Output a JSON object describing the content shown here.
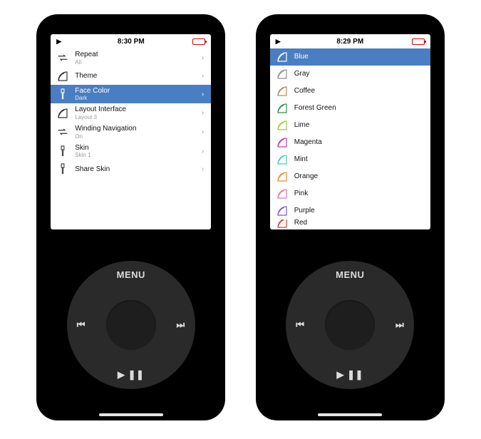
{
  "left": {
    "status": {
      "play_glyph": "▶",
      "time": "8:30 PM"
    },
    "items": [
      {
        "icon": "repeat",
        "label": "Repeat",
        "sub": "All",
        "chev": "›",
        "selected": false
      },
      {
        "icon": "fan",
        "label": "Theme",
        "sub": "",
        "chev": "›",
        "selected": false
      },
      {
        "icon": "brush",
        "label": "Face Color",
        "sub": "Dark",
        "chev": "›",
        "selected": true
      },
      {
        "icon": "fan",
        "label": "Layout Interface",
        "sub": "Layout 3",
        "chev": "›",
        "selected": false
      },
      {
        "icon": "repeat",
        "label": "Winding Navigation",
        "sub": "On",
        "chev": "›",
        "selected": false
      },
      {
        "icon": "brush",
        "label": "Skin",
        "sub": "Skin 1",
        "chev": "›",
        "selected": false
      },
      {
        "icon": "brush",
        "label": "Share Skin",
        "sub": "",
        "chev": "›",
        "selected": false
      }
    ],
    "wheel": {
      "menu": "MENU",
      "prev": "⏮",
      "next": "⏭",
      "play": "▶ ❚❚"
    }
  },
  "right": {
    "status": {
      "play_glyph": "▶",
      "time": "8:29 PM"
    },
    "items": [
      {
        "color": "#ffffff",
        "label": "Blue",
        "chev": "",
        "selected": true
      },
      {
        "color": "#8f8f8f",
        "label": "Gray",
        "chev": "",
        "selected": false
      },
      {
        "color": "#b58a5a",
        "label": "Coffee",
        "chev": "",
        "selected": false
      },
      {
        "color": "#2f8f57",
        "label": "Forest Green",
        "chev": "",
        "selected": false
      },
      {
        "color": "#9acd32",
        "label": "Lime",
        "chev": "",
        "selected": false
      },
      {
        "color": "#c43aa8",
        "label": "Magenta",
        "chev": "",
        "selected": false
      },
      {
        "color": "#3fd1b4",
        "label": "Mint",
        "chev": "",
        "selected": false
      },
      {
        "color": "#f08a2d",
        "label": "Orange",
        "chev": "",
        "selected": false
      },
      {
        "color": "#f06fa6",
        "label": "Pink",
        "chev": "",
        "selected": false
      },
      {
        "color": "#7b5bd6",
        "label": "Purple",
        "chev": "",
        "selected": false
      },
      {
        "color": "#e23b3b",
        "label": "Red",
        "chev": "",
        "selected": false,
        "partial": true
      }
    ],
    "wheel": {
      "menu": "MENU",
      "prev": "⏮",
      "next": "⏭",
      "play": "▶ ❚❚"
    }
  }
}
